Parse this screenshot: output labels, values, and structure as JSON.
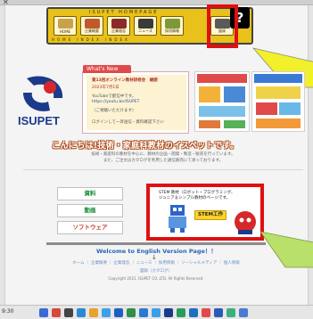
{
  "window": {
    "close_glyph": "✕"
  },
  "nav": {
    "site_name": "ISUPET HOMEPAGE",
    "subcaption": "HOME  INDEX  INDEX",
    "items": [
      {
        "label": "HOME",
        "icon": "home-icon",
        "color": "#c8a24a"
      },
      {
        "label": "企業概要",
        "icon": "building-icon",
        "color": "#c05a2a"
      },
      {
        "label": "企業理念",
        "icon": "heart-icon",
        "color": "#8a2a2a"
      },
      {
        "label": "ニュース",
        "icon": "news-icon",
        "color": "#3a3a3a"
      },
      {
        "label": "採用情報",
        "icon": "recruit-icon",
        "color": "#7a9a3a"
      },
      {
        "label": "図録",
        "icon": "catalog-icon",
        "color": "#5a5a5a"
      }
    ],
    "help_label": "?"
  },
  "logo": {
    "brand": "ISUPET",
    "mark_color": "#1b3a8c",
    "accent": "#d62828"
  },
  "news": {
    "tab": "What's New",
    "lines": [
      "第13回オンライン教材研修会　継続",
      "2023年7月1日",
      "YouTubeで配信中です。",
      "https://youtu.be/ISUPET",
      "（ご視聴いただけます）",
      "ログインして一斉送信・資料確認下さい"
    ]
  },
  "tagline": "こんにちは!技術・家庭科教材のイスペットです。",
  "intro": [
    "技術・家庭科の教材を中心に、教材の企画・開発・製造・販売を行っています。",
    "また、ご注文はカタログを利用した通信販売にて承っております。"
  ],
  "left_buttons": [
    {
      "label": "資料",
      "tone": "green"
    },
    {
      "label": "動画",
      "tone": "green"
    },
    {
      "label": "ソフトウェア",
      "tone": "red"
    }
  ],
  "stem": {
    "line1": "STEM 教材（ロボット・プログラミング、",
    "line2": "ジュニア＆シンプル教材のページです。",
    "badge": "STEM工作"
  },
  "english": "Welcome to English Version Page！！",
  "bottom_mark": "↓",
  "footer_links": "ホーム ｜ 企業概要 ｜ 企業理念 ｜ ニュース ｜ 採用情報 ｜ ソーシャルメディア ｜ 個人情報",
  "footer_links2": "図録（カタログ）",
  "copyright": "Copyright 2021. ISUPET CO.,LTD. All Rights Reserved.",
  "taskbar": {
    "time": "9:30"
  },
  "colors": {
    "highlight": "#e01010",
    "callout": "#f2f02a",
    "nav_bg": "#e8c11a"
  }
}
